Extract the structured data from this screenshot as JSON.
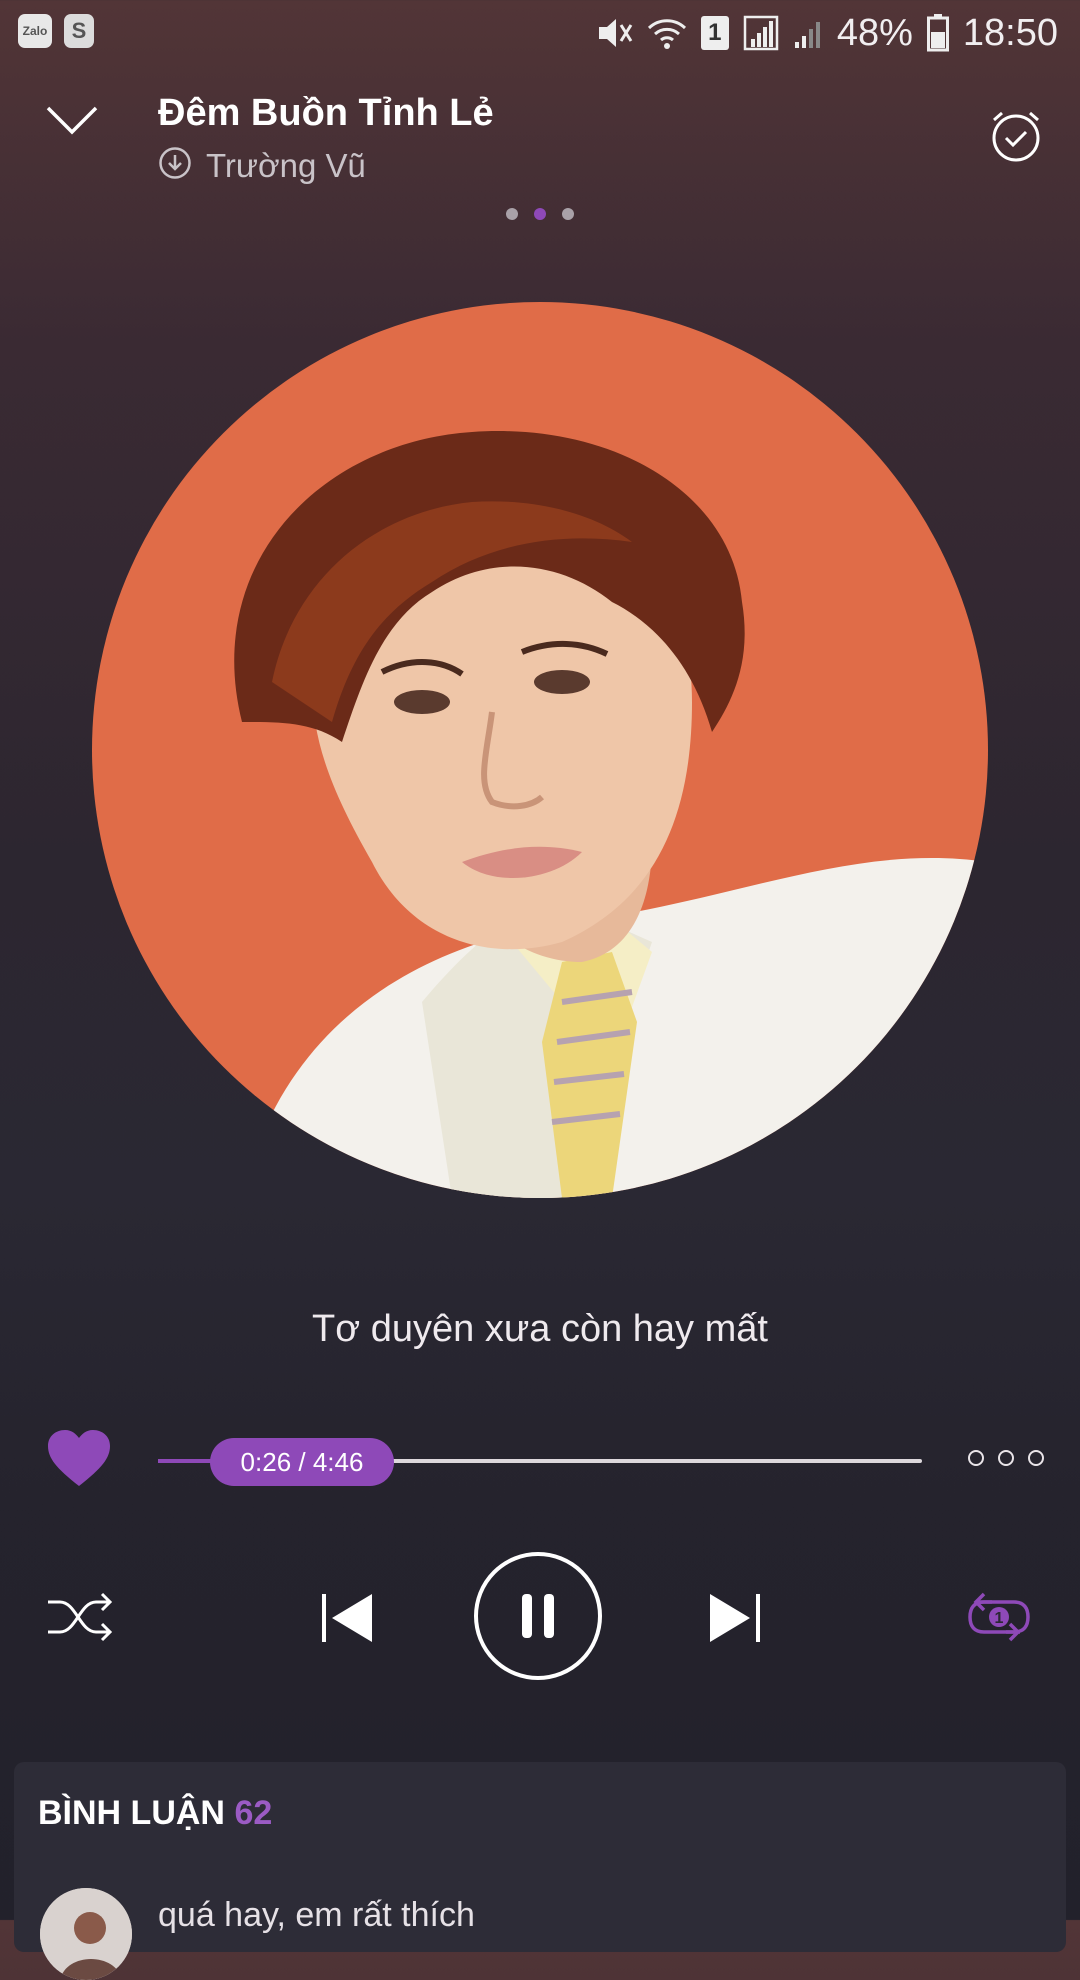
{
  "status_bar": {
    "apps": [
      "Zalo",
      "S"
    ],
    "sim_badge": "1",
    "battery": "48%",
    "time": "18:50"
  },
  "header": {
    "title": "Đêm Buồn Tỉnh Lẻ",
    "artist": "Trường Vũ",
    "page_dots": 3,
    "active_dot": 2
  },
  "lyric": "Tơ duyên xưa còn hay mất",
  "player": {
    "time_label": "0:26 / 4:46",
    "progress_fraction": 0.091,
    "liked": true,
    "repeat_badge": "1"
  },
  "comments": {
    "title": "BÌNH LUẬN",
    "count": "62",
    "first_comment": "quá hay, em rất thích"
  },
  "colors": {
    "accent": "#8e49b8",
    "art_background": "#e06c48"
  }
}
